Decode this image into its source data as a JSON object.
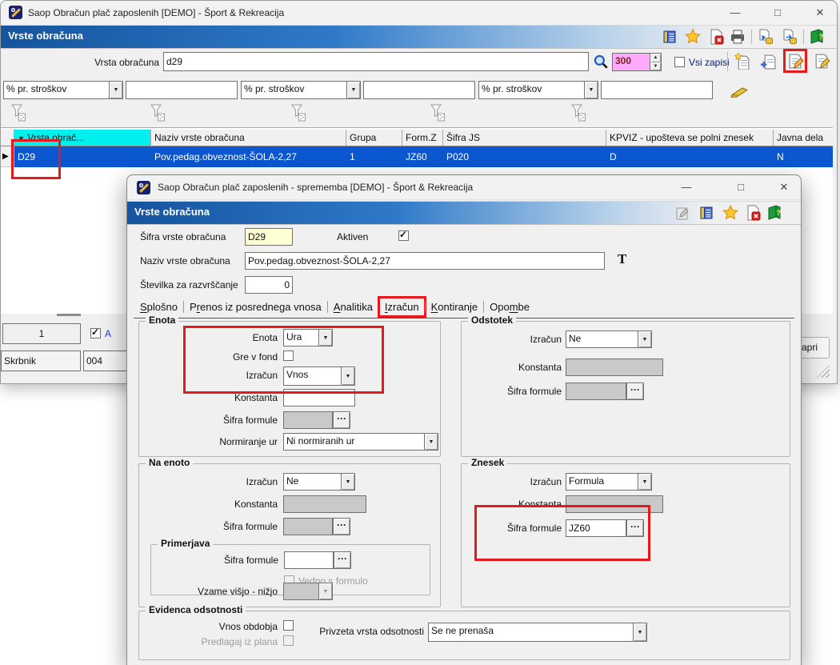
{
  "ui": {
    "ellipsis": "···",
    "minimize": "—",
    "maximize": "□",
    "close": "✕"
  },
  "colors": {
    "caption_blue": "#15549f",
    "selection_blue": "#0b57d0",
    "header_cyan": "#00f0f0",
    "annotation_red": "#e8191c",
    "record_count_pink": "#ffaaff",
    "code_field_cream": "#ffffd6"
  },
  "main_window": {
    "title": "Saop Obračun plač zaposlenih [DEMO] - Šport & Rekreacija",
    "caption": "Vrste obračuna",
    "search": {
      "label": "Vrsta obračuna",
      "value": "d29",
      "count": "300",
      "all_label": "Vsi zapisi",
      "all_checked": false
    },
    "filters": {
      "combos": [
        "% pr. stroškov",
        "% pr. stroškov",
        "% pr. stroškov"
      ],
      "inputs": [
        "",
        "",
        ""
      ]
    },
    "table": {
      "sorted_column_arrow": "▼",
      "columns": [
        "Vrsta obrač...",
        "Naziv vrste obračuna",
        "Grupa",
        "Form.Z",
        "Šifra JS",
        "KPVIZ - upošteva se polni znesek",
        "Javna dela"
      ],
      "row": [
        "D29",
        "Pov.pedag.obveznost-ŠOLA-2,27",
        "1",
        "JZ60",
        "P020",
        "D",
        "N"
      ],
      "row_marker": "▶"
    },
    "status": {
      "count": "1",
      "flag": "A",
      "flag_checked": true,
      "user": "Skrbnik",
      "code": "004",
      "close_button_partial": "apri"
    }
  },
  "dialog": {
    "title": "Saop Obračun plač zaposlenih - sprememba [DEMO] - Šport & Rekreacija",
    "caption": "Vrste obračuna",
    "fields": {
      "sifra_label": "Šifra vrste obračuna",
      "sifra_value": "D29",
      "aktiven_label": "Aktiven",
      "aktiven_checked": true,
      "naziv_label": "Naziv vrste obračuna",
      "naziv_value": "Pov.pedag.obveznost-ŠOLA-2,27",
      "font_icon_glyph": "T",
      "stevilka_label": "Številka za razvrščanje",
      "stevilka_value": "0"
    },
    "tabs": [
      {
        "label": "Splošno",
        "accel": 0
      },
      {
        "label": "Prenos iz posrednega vnosa",
        "accel": 1
      },
      {
        "label": "Analitika",
        "accel": 0
      },
      {
        "label": "Izračun",
        "accel": 0,
        "active": true
      },
      {
        "label": "Kontiranje",
        "accel": 0
      },
      {
        "label": "Opombe",
        "accel": 3
      }
    ],
    "enota": {
      "legend": "Enota",
      "enota_label": "Enota",
      "enota_value": "Ura",
      "fond_label": "Gre v fond",
      "fond_checked": false,
      "izracun_label": "Izračun",
      "izracun_value": "Vnos",
      "konstanta_label": "Konstanta",
      "konstanta_value": "",
      "formula_label": "Šifra formule",
      "formula_value": "",
      "normiranje_label": "Normiranje ur",
      "normiranje_value": "Ni normiranih ur"
    },
    "odstotek": {
      "legend": "Odstotek",
      "izracun_label": "Izračun",
      "izracun_value": "Ne",
      "konstanta_label": "Konstanta",
      "konstanta_value": "",
      "formula_label": "Šifra formule",
      "formula_value": ""
    },
    "na_enoto": {
      "legend": "Na enoto",
      "izracun_label": "Izračun",
      "izracun_value": "Ne",
      "konstanta_label": "Konstanta",
      "konstanta_value": "",
      "formula_label": "Šifra formule",
      "formula_value": ""
    },
    "primerjava": {
      "legend": "Primerjava",
      "formula_label": "Šifra formule",
      "formula_value": "",
      "vedno_label": "Vedno s formulo",
      "vedno_checked": false
    },
    "vzame_label": "Vzame višjo - nižjo",
    "znesek": {
      "legend": "Znesek",
      "izracun_label": "Izračun",
      "izracun_value": "Formula",
      "konstanta_label": "Konstanta",
      "konstanta_value": "",
      "formula_label": "Šifra formule",
      "formula_value": "JZ60"
    },
    "evidenca": {
      "legend": "Evidenca odsotnosti",
      "vnos_label": "Vnos obdobja",
      "vnos_checked": false,
      "predlagaj_label": "Predlagaj iz plana",
      "predlagaj_checked": false,
      "privzeta_label": "Privzeta vrsta odsotnosti",
      "privzeta_value": "Se ne prenaša"
    }
  }
}
